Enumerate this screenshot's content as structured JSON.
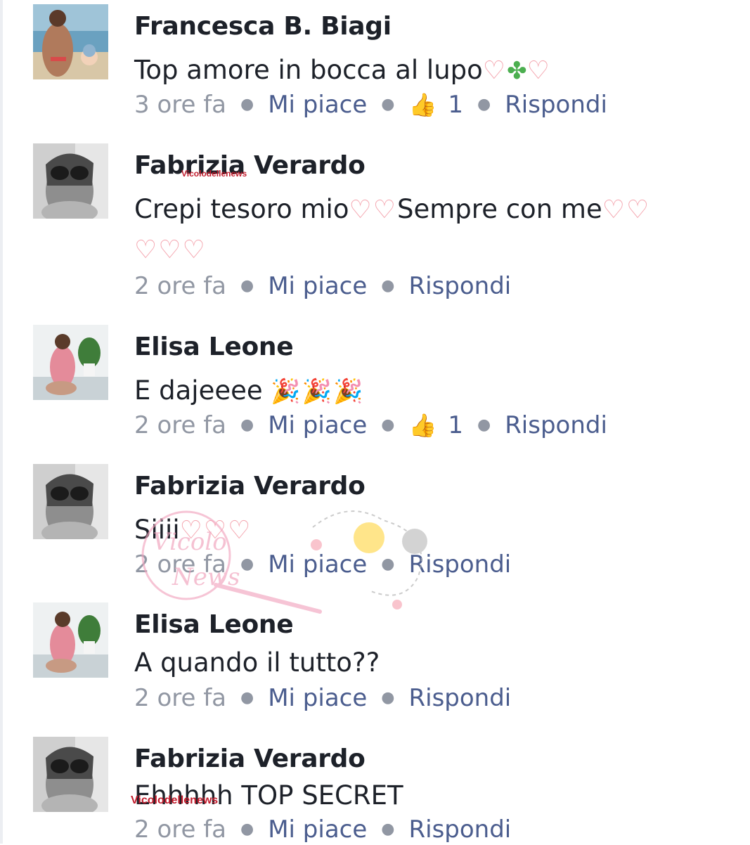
{
  "comments": [
    {
      "name": "Francesca B. Biagi",
      "text": "Top amore in bocca al lupo",
      "emoji_hearts_a": "♡",
      "emoji_clover": "✤",
      "emoji_hearts_b": "♡",
      "time": "3 ore fa",
      "like": "Mi piace",
      "likes": "1",
      "reply": "Rispondi",
      "avatar_style": "beach"
    },
    {
      "name": "Fabrizia Verardo",
      "text": "Crepi tesoro mio",
      "hearts_1": "♡♡",
      "text_2": "Sempre con me",
      "hearts_2": "♡♡",
      "hearts_3": "♡♡♡",
      "time": "2 ore fa",
      "like": "Mi piace",
      "reply": "Rispondi",
      "avatar_style": "sunglasses"
    },
    {
      "name": "Elisa Leone",
      "text": "E dajeeee ",
      "emoji": "🎉🎉🎉",
      "time": "2 ore fa",
      "like": "Mi piace",
      "likes": "1",
      "reply": "Rispondi",
      "avatar_style": "plant"
    },
    {
      "name": "Fabrizia Verardo",
      "text": "Siiii",
      "hearts": "♡♡♡",
      "time": "2 ore fa",
      "like": "Mi piace",
      "reply": "Rispondi",
      "avatar_style": "sunglasses"
    },
    {
      "name": "Elisa Leone",
      "text": "A quando il tutto??",
      "time": "2 ore fa",
      "like": "Mi piace",
      "reply": "Rispondi",
      "avatar_style": "plant"
    },
    {
      "name": "Fabrizia Verardo",
      "text": "Ehhhhh TOP SECRET",
      "time": "2 ore fa",
      "like": "Mi piace",
      "reply": "Rispondi",
      "avatar_style": "sunglasses"
    }
  ],
  "watermark": "Vicolodellenews",
  "watermark_small": "Vicolodellenews",
  "stamp": {
    "line1": "Vicolo",
    "line2": "News"
  },
  "colors": {
    "link": "#4b5d8e",
    "meta": "#9197a3",
    "name": "#1d2129",
    "heart": "#f4a3ad"
  }
}
